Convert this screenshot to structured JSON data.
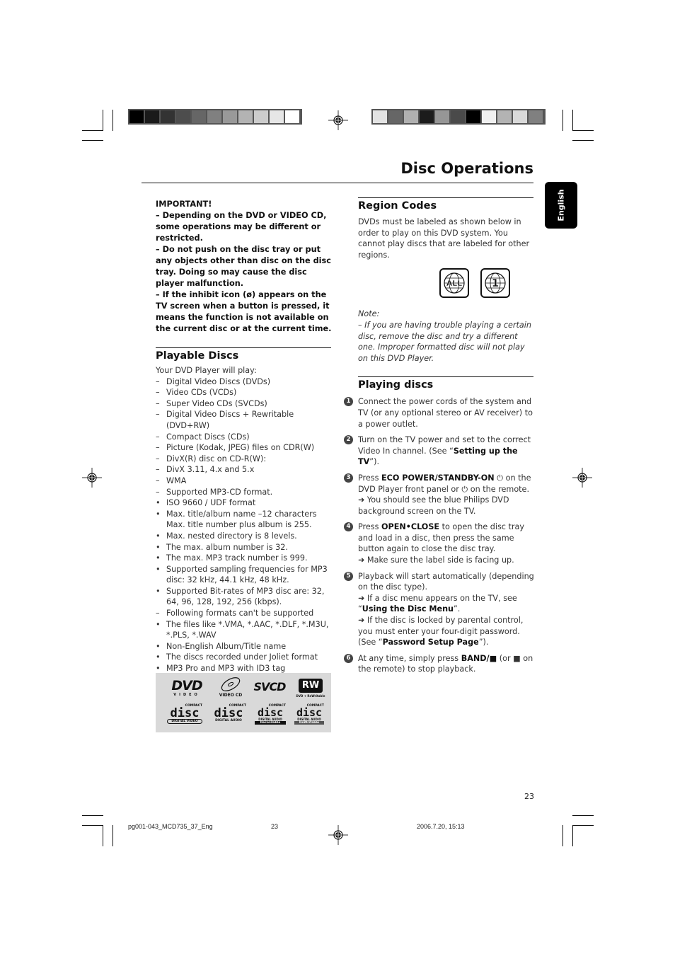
{
  "page": {
    "title": "Disc Operations",
    "language_tab": "English",
    "page_number": "23"
  },
  "important": {
    "heading": "IMPORTANT!",
    "items": [
      "–   Depending on the DVD or VIDEO CD, some operations may be different or restricted.",
      "–   Do not push on the disc tray or put any objects other than disc on the disc tray. Doing so may cause the disc player malfunction.",
      "–   If the inhibit icon (ø) appears on the TV screen when a button is pressed, it means the function is not available on the current disc or at the current time."
    ]
  },
  "playable_discs": {
    "heading": "Playable Discs",
    "intro": "Your DVD Player will play:",
    "items": [
      {
        "marker": "–",
        "text": "Digital Video Discs (DVDs)"
      },
      {
        "marker": "–",
        "text": "Video CDs (VCDs)"
      },
      {
        "marker": "–",
        "text": "Super Video CDs (SVCDs)"
      },
      {
        "marker": "–",
        "text": "Digital Video Discs + Rewritable (DVD+RW)"
      },
      {
        "marker": "–",
        "text": "Compact Discs (CDs)"
      },
      {
        "marker": "–",
        "text": "Picture (Kodak, JPEG) files on CDR(W)"
      },
      {
        "marker": "–",
        "text": "DivX(R) disc on CD-R(W):"
      },
      {
        "marker": "–",
        "text": "DivX 3.11, 4.x and 5.x"
      },
      {
        "marker": "–",
        "text": "WMA"
      },
      {
        "marker": "–",
        "text": "Supported MP3-CD format."
      },
      {
        "marker": "•",
        "text": "ISO 9660 / UDF format"
      },
      {
        "marker": "•",
        "text": "Max. title/album name –12 characters Max. title number plus album is 255."
      },
      {
        "marker": "•",
        "text": "Max. nested directory is 8 levels."
      },
      {
        "marker": "•",
        "text": "The max. album number is 32."
      },
      {
        "marker": "•",
        "text": "The max. MP3 track number is 999."
      },
      {
        "marker": "•",
        "text": "Supported sampling frequencies for MP3 disc: 32 kHz, 44.1 kHz, 48 kHz."
      },
      {
        "marker": "•",
        "text": "Supported Bit-rates of MP3 disc are: 32, 64, 96, 128, 192, 256 (kbps)."
      },
      {
        "marker": "–",
        "text": "Following formats can't be supported"
      },
      {
        "marker": "•",
        "text": "The files like *.VMA, *.AAC, *.DLF, *.M3U, *.PLS, *.WAV"
      },
      {
        "marker": "•",
        "text": "Non-English Album/Title name"
      },
      {
        "marker": "•",
        "text": "The discs recorded under Joliet format"
      },
      {
        "marker": "•",
        "text": "MP3 Pro and MP3 with ID3 tag"
      }
    ],
    "logos": {
      "dvd": "DVD",
      "dvd_sub": "VIDEO",
      "vcd": "VIDEO CD",
      "svcd": "SVCD",
      "rw": "RW",
      "rw_sub": "DVD + ReWritable",
      "cd_top": "COMPACT",
      "cd_main": "disc",
      "cd1_sub": "DIGITAL VIDEO",
      "cd2_sub": "DIGITAL AUDIO",
      "cd3_sub": "DIGITAL AUDIO",
      "cd3_tag": "Recordable",
      "cd4_sub": "DIGITAL AUDIO",
      "cd4_tag": "ReWritable"
    }
  },
  "region_codes": {
    "heading": "Region Codes",
    "body": "DVDs must be labeled as shown below in order to play on this DVD system. You cannot play discs that are labeled for other regions.",
    "icons": [
      "ALL",
      "1"
    ],
    "note_label": "Note:",
    "note_text": "–  If you are having trouble playing a certain disc, remove the disc and try a different one. Improper formatted disc will not play on this DVD Player."
  },
  "playing_discs": {
    "heading": "Playing discs",
    "steps": [
      {
        "num": "1",
        "parts": [
          {
            "t": "Connect the power cords of the system and TV (or any optional stereo or AV receiver) to a power outlet."
          }
        ]
      },
      {
        "num": "2",
        "parts": [
          {
            "t": "Turn on the TV power and set to the correct Video In channel. (See “"
          },
          {
            "t": "Setting up the TV",
            "b": true
          },
          {
            "t": "”)."
          }
        ]
      },
      {
        "num": "3",
        "parts": [
          {
            "t": "Press "
          },
          {
            "t": "ECO POWER/STANDBY-ON",
            "b": true
          },
          {
            "t": " ⏻ on the DVD Player front panel or ⏻ on the remote."
          },
          {
            "t": "➜ You should see the blue Philips DVD background screen on the TV.",
            "br": true
          }
        ]
      },
      {
        "num": "4",
        "parts": [
          {
            "t": "Press "
          },
          {
            "t": "OPEN•CLOSE",
            "b": true
          },
          {
            "t": " to open the disc tray and load in a disc, then press the same button again to close the disc tray."
          },
          {
            "t": "➜ Make sure the label side is facing up.",
            "br": true
          }
        ]
      },
      {
        "num": "5",
        "parts": [
          {
            "t": "Playback will start automatically (depending on the disc type)."
          },
          {
            "t": "➜ If a disc menu appears on the TV, see “",
            "br": true
          },
          {
            "t": "Using the Disc Menu",
            "b": true
          },
          {
            "t": "”."
          },
          {
            "t": "➜ If the disc is locked by parental control, you must enter your four-digit password. (See “",
            "br": true
          },
          {
            "t": "Password Setup Page",
            "b": true
          },
          {
            "t": "”)."
          }
        ]
      },
      {
        "num": "6",
        "parts": [
          {
            "t": "At any time, simply press "
          },
          {
            "t": "BAND/■",
            "b": true
          },
          {
            "t": " (or ■  on the remote) to stop playback."
          }
        ]
      }
    ]
  },
  "footer": {
    "file": "pg001-043_MCD735_37_Eng",
    "page": "23",
    "timestamp": "2006.7.20, 15:13"
  },
  "color_bars": {
    "left": [
      "#000000",
      "#1a1a1a",
      "#333333",
      "#4d4d4d",
      "#666666",
      "#808080",
      "#999999",
      "#b3b3b3",
      "#cccccc",
      "#e6e6e6",
      "#ffffff"
    ],
    "right": [
      "#e3e3e3",
      "#666666",
      "#b0b0b0",
      "#1c1c1c",
      "#969696",
      "#4a4a4a",
      "#000000",
      "#f0f0f0",
      "#b3b3b3",
      "#d9d9d9",
      "#808080"
    ]
  }
}
